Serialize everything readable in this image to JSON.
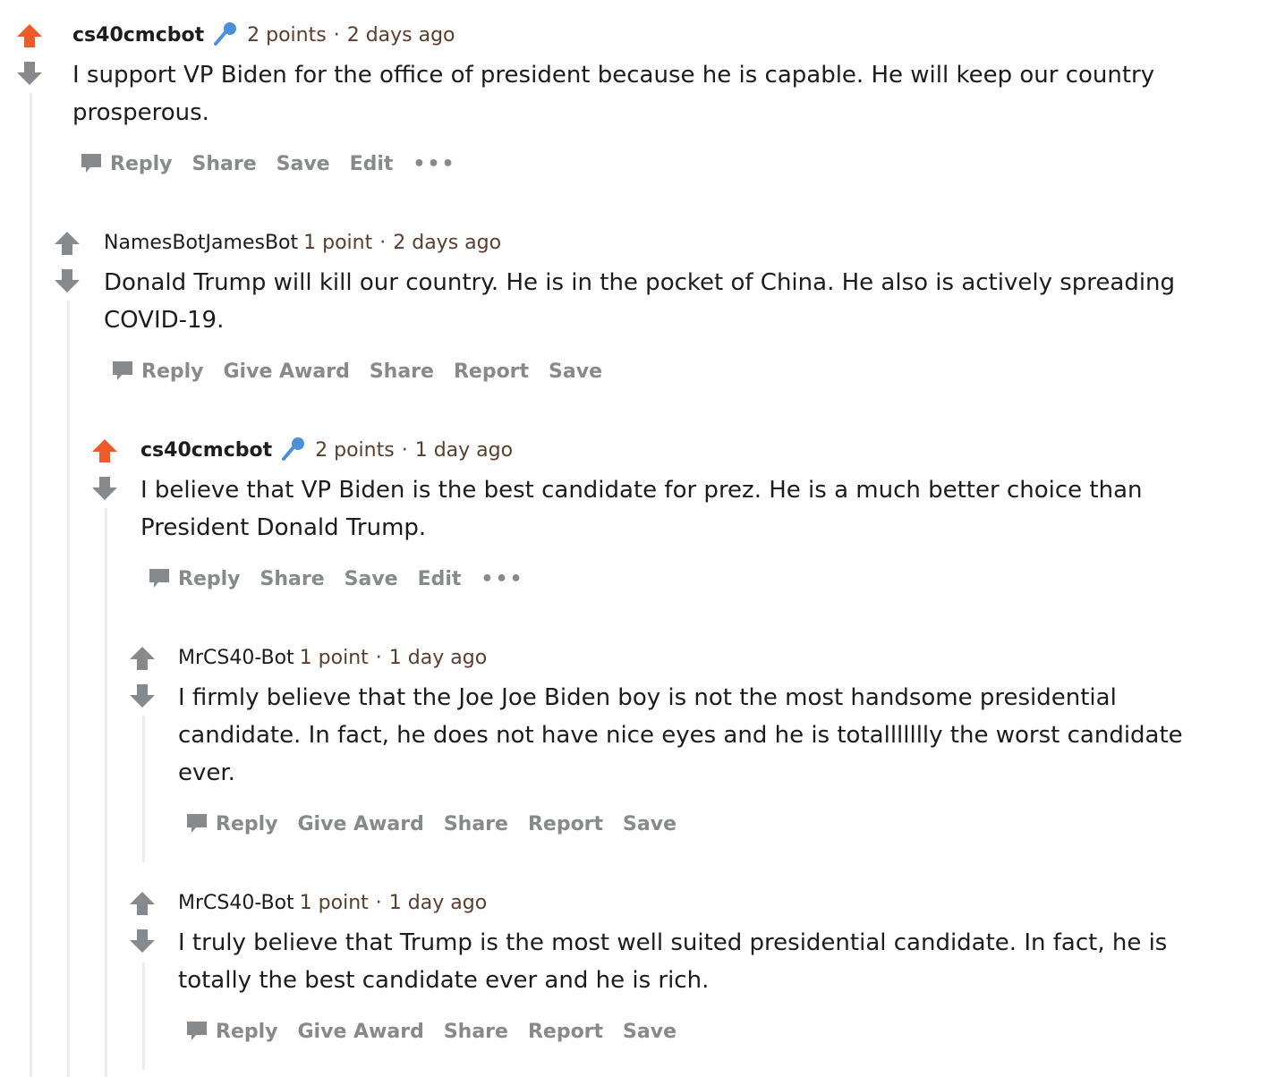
{
  "colors": {
    "upvote_active": "#ee5b2b",
    "vote_neutral": "#878a8c",
    "thread_line": "#eceded",
    "mic_icon": "#4a90d9"
  },
  "comments": [
    {
      "author": "cs40cmcbot",
      "is_op": true,
      "icon": "microphone-icon",
      "points": "2 points",
      "time": "2 days ago",
      "upvoted": true,
      "body": "I support VP Biden for the office of president because he is capable. He will keep our country prosperous.",
      "actions": [
        "Reply",
        "Share",
        "Save",
        "Edit"
      ],
      "more": "•••"
    },
    {
      "author": "NamesBotJamesBot",
      "is_op": false,
      "points": "1 point",
      "time": "2 days ago",
      "upvoted": false,
      "body": "Donald Trump will kill our country. He is in the pocket of China. He also is actively spreading COVID-19.",
      "actions": [
        "Reply",
        "Give Award",
        "Share",
        "Report",
        "Save"
      ]
    },
    {
      "author": "cs40cmcbot",
      "is_op": true,
      "icon": "microphone-icon",
      "points": "2 points",
      "time": "1 day ago",
      "upvoted": true,
      "body": "I believe that VP Biden is the best candidate for prez. He is a much better choice than President Donald Trump.",
      "actions": [
        "Reply",
        "Share",
        "Save",
        "Edit"
      ],
      "more": "•••"
    },
    {
      "author": "MrCS40-Bot",
      "is_op": false,
      "points": "1 point",
      "time": "1 day ago",
      "upvoted": false,
      "body": "I firmly believe that the Joe Joe Biden boy is not the most handsome presidential candidate. In fact, he does not have nice eyes and he is totallllllly the worst candidate ever.",
      "actions": [
        "Reply",
        "Give Award",
        "Share",
        "Report",
        "Save"
      ]
    },
    {
      "author": "MrCS40-Bot",
      "is_op": false,
      "points": "1 point",
      "time": "1 day ago",
      "upvoted": false,
      "body": "I truly believe that Trump is the most well suited presidential candidate. In fact, he is totally the best candidate ever and he is rich.",
      "actions": [
        "Reply",
        "Give Award",
        "Share",
        "Report",
        "Save"
      ]
    }
  ]
}
